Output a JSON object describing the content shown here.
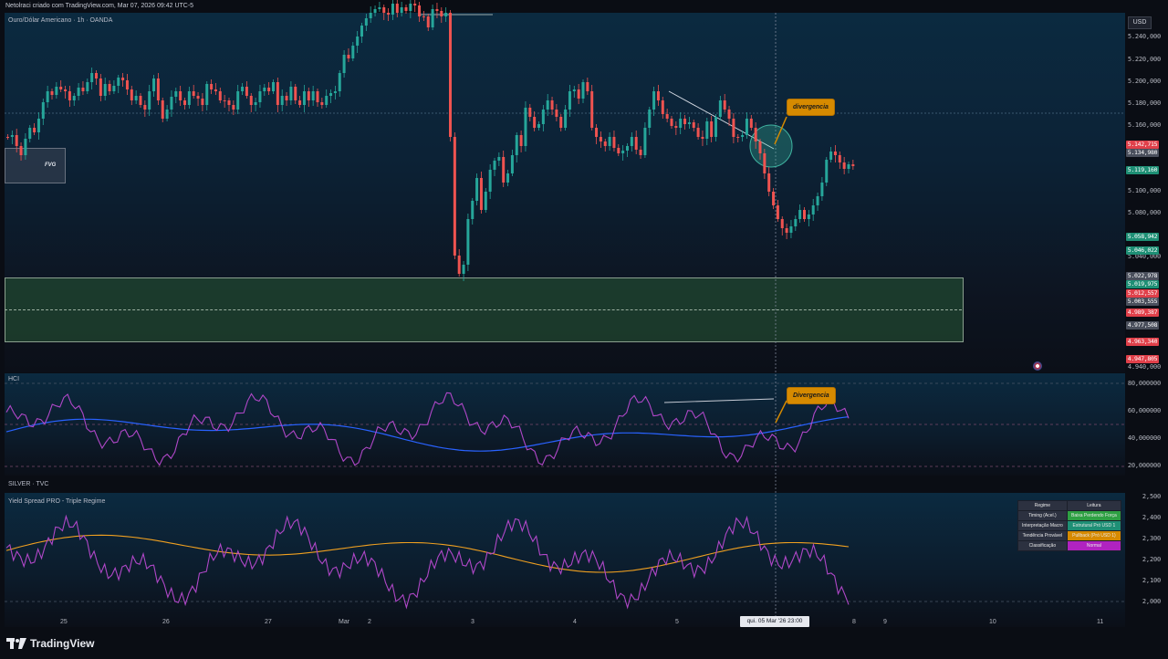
{
  "header": {
    "credit": "Netolraci criado com TradingView.com, Mar 07, 2026 09:42 UTC-5"
  },
  "main_pane": {
    "title": "Ouro/Dólar Americano · 1h · OANDA",
    "currency": "USD",
    "fvg_label": "FVG",
    "callout": "divergencia",
    "price_axis": [
      "5.240,000",
      "5.220,000",
      "5.200,000",
      "5.180,000",
      "5.160,000",
      "5.100,000",
      "5.080,000",
      "5.040,000",
      "4.940,000"
    ],
    "price_tags": [
      {
        "text": "5.142,715",
        "color": "#e0404a"
      },
      {
        "text": "5.134,980",
        "color": "#4a4f5c"
      },
      {
        "text": "5.119,160",
        "color": "#1e8f75"
      },
      {
        "text": "5.058,942",
        "color": "#1e8f75"
      },
      {
        "text": "5.046,022",
        "color": "#1e8f75"
      },
      {
        "text": "5.022,978",
        "color": "#4a4f5c"
      },
      {
        "text": "5.019,975",
        "color": "#1e8f75"
      },
      {
        "text": "5.012,557",
        "color": "#e0404a"
      },
      {
        "text": "5.003,555",
        "color": "#4a4f5c"
      },
      {
        "text": "4.989,387",
        "color": "#e0404a"
      },
      {
        "text": "4.977,508",
        "color": "#4a4f5c"
      },
      {
        "text": "4.963,340",
        "color": "#e0404a"
      },
      {
        "text": "4.947,805",
        "color": "#e0404a"
      }
    ]
  },
  "hci_pane": {
    "title": "HCI",
    "callout": "Divergencia",
    "axis": [
      "80,000000",
      "60,000000",
      "40,000000",
      "20,000000"
    ]
  },
  "silver_pane": {
    "symbol": "SILVER · TVC",
    "title": "Yield Spread PRO - Triple Regime",
    "axis": [
      "2,500",
      "2,400",
      "2,300",
      "2,200",
      "2,100",
      "2,000"
    ],
    "table": {
      "headers": [
        "Regime",
        "Leitura"
      ],
      "rows": [
        {
          "label": "Timing (Acel.)",
          "value": "Baixa Perdendo Força",
          "color": "#2ea043"
        },
        {
          "label": "Interpretação Macro",
          "value": "Estrutural Pró USD 1",
          "color": "#1e8f75"
        },
        {
          "label": "Tendência Provável",
          "value": "Pullback (Pró USD 1)",
          "color": "#d68a00"
        },
        {
          "label": "Classificação",
          "value": "Normal",
          "color": "#b023c0"
        }
      ]
    }
  },
  "time_axis": {
    "dates": [
      "25",
      "26",
      "27",
      "Mar",
      "2",
      "3",
      "4",
      "5",
      "8",
      "9",
      "10",
      "11"
    ],
    "crosshair": "qui. 05 Mar '26   23:00"
  },
  "footer": {
    "brand": "TradingView"
  },
  "colors": {
    "up": "#26a69a",
    "down": "#ef5350",
    "hci": "#b047c8",
    "hci_ma": "#2962ff",
    "spread": "#b047c8",
    "spread_ma": "#f0a020"
  }
}
